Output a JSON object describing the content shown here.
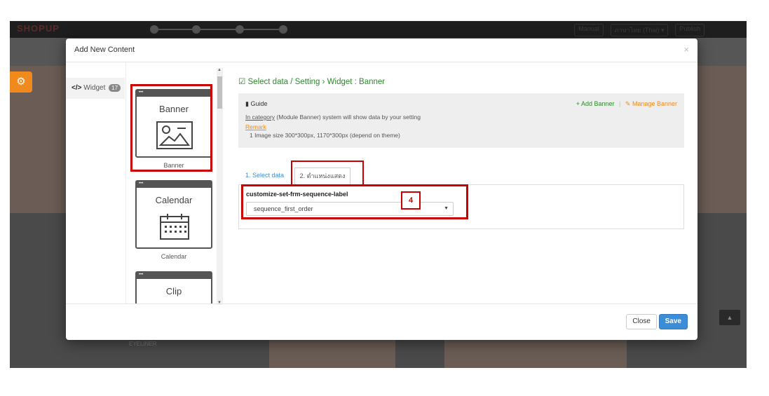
{
  "app": {
    "logo": "SHOPUP",
    "toolbar": {
      "manual_label": "Manual",
      "language_label": "ภาษาไทย (Thai) ▾",
      "publish_label": "Publish"
    },
    "bg_caption": "EYELINER",
    "scroll_top_icon": "chevron-up-icon"
  },
  "modal": {
    "title": "Add New Content",
    "close_symbol": "×",
    "footer": {
      "close_label": "Close",
      "save_label": "Save"
    }
  },
  "categories": [
    {
      "icon_text": "</>",
      "label": "Widget",
      "count": "17"
    }
  ],
  "widgets": [
    {
      "name": "Banner",
      "caption": "Banner",
      "icon": "image-icon",
      "selected": true
    },
    {
      "name": "Calendar",
      "caption": "Calendar",
      "icon": "calendar-icon",
      "selected": false
    },
    {
      "name": "Clip",
      "caption": "",
      "icon": "clip-icon",
      "selected": false
    }
  ],
  "content": {
    "breadcrumb": "Select data / Setting › Widget : Banner",
    "guide": {
      "title": "Guide",
      "add_banner_label": "+ Add Banner",
      "separator": "|",
      "manage_banner_label": "Manage Banner",
      "line1_link": "In category",
      "line1_text": " (Module Banner) system will show data by your setting",
      "remark_label": "Remark",
      "line3": "1 Image size 300*300px, 1170*300px (depend on theme)"
    },
    "tabs": [
      {
        "label": "1. Select data",
        "active": false
      },
      {
        "label": "2. ตำแหน่งแสดง",
        "active": true
      }
    ],
    "field": {
      "label": "customize-set-frm-sequence-label",
      "value": "sequence_first_order"
    },
    "annotation_step": "4"
  },
  "colors": {
    "accent_green": "#2a8a2a",
    "accent_orange": "#f08a1c",
    "save_blue": "#3c8dd8",
    "highlight_red": "#c80000"
  }
}
